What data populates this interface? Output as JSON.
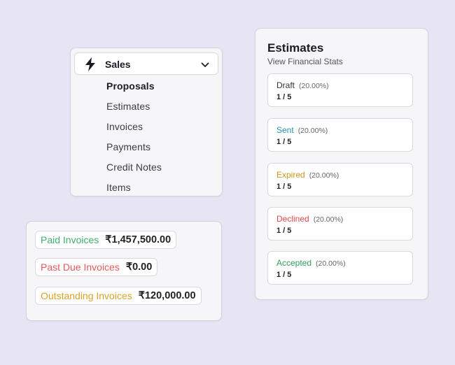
{
  "sales_menu": {
    "title": "Sales",
    "items": [
      {
        "label": "Proposals",
        "active": true
      },
      {
        "label": "Estimates",
        "active": false
      },
      {
        "label": "Invoices",
        "active": false
      },
      {
        "label": "Payments",
        "active": false
      },
      {
        "label": "Credit Notes",
        "active": false
      },
      {
        "label": "Items",
        "active": false
      }
    ]
  },
  "invoice_summary": [
    {
      "label": "Paid Invoices",
      "amount": "₹1,457,500.00",
      "color": "#3fae6a"
    },
    {
      "label": "Past Due Invoices",
      "amount": "₹0.00",
      "color": "#e85a5a"
    },
    {
      "label": "Outstanding Invoices",
      "amount": "₹120,000.00",
      "color": "#d9a227"
    }
  ],
  "estimates": {
    "title": "Estimates",
    "subtitle": "View Financial Stats",
    "stats": [
      {
        "name": "Draft",
        "percent": "(20.00%)",
        "count": "1 / 5",
        "color": "#333333"
      },
      {
        "name": "Sent",
        "percent": "(20.00%)",
        "count": "1 / 5",
        "color": "#2a8fb5"
      },
      {
        "name": "Expired",
        "percent": "(20.00%)",
        "count": "1 / 5",
        "color": "#c8951c"
      },
      {
        "name": "Declined",
        "percent": "(20.00%)",
        "count": "1 / 5",
        "color": "#e04848"
      },
      {
        "name": "Accepted",
        "percent": "(20.00%)",
        "count": "1 / 5",
        "color": "#2e9e5a"
      }
    ]
  }
}
